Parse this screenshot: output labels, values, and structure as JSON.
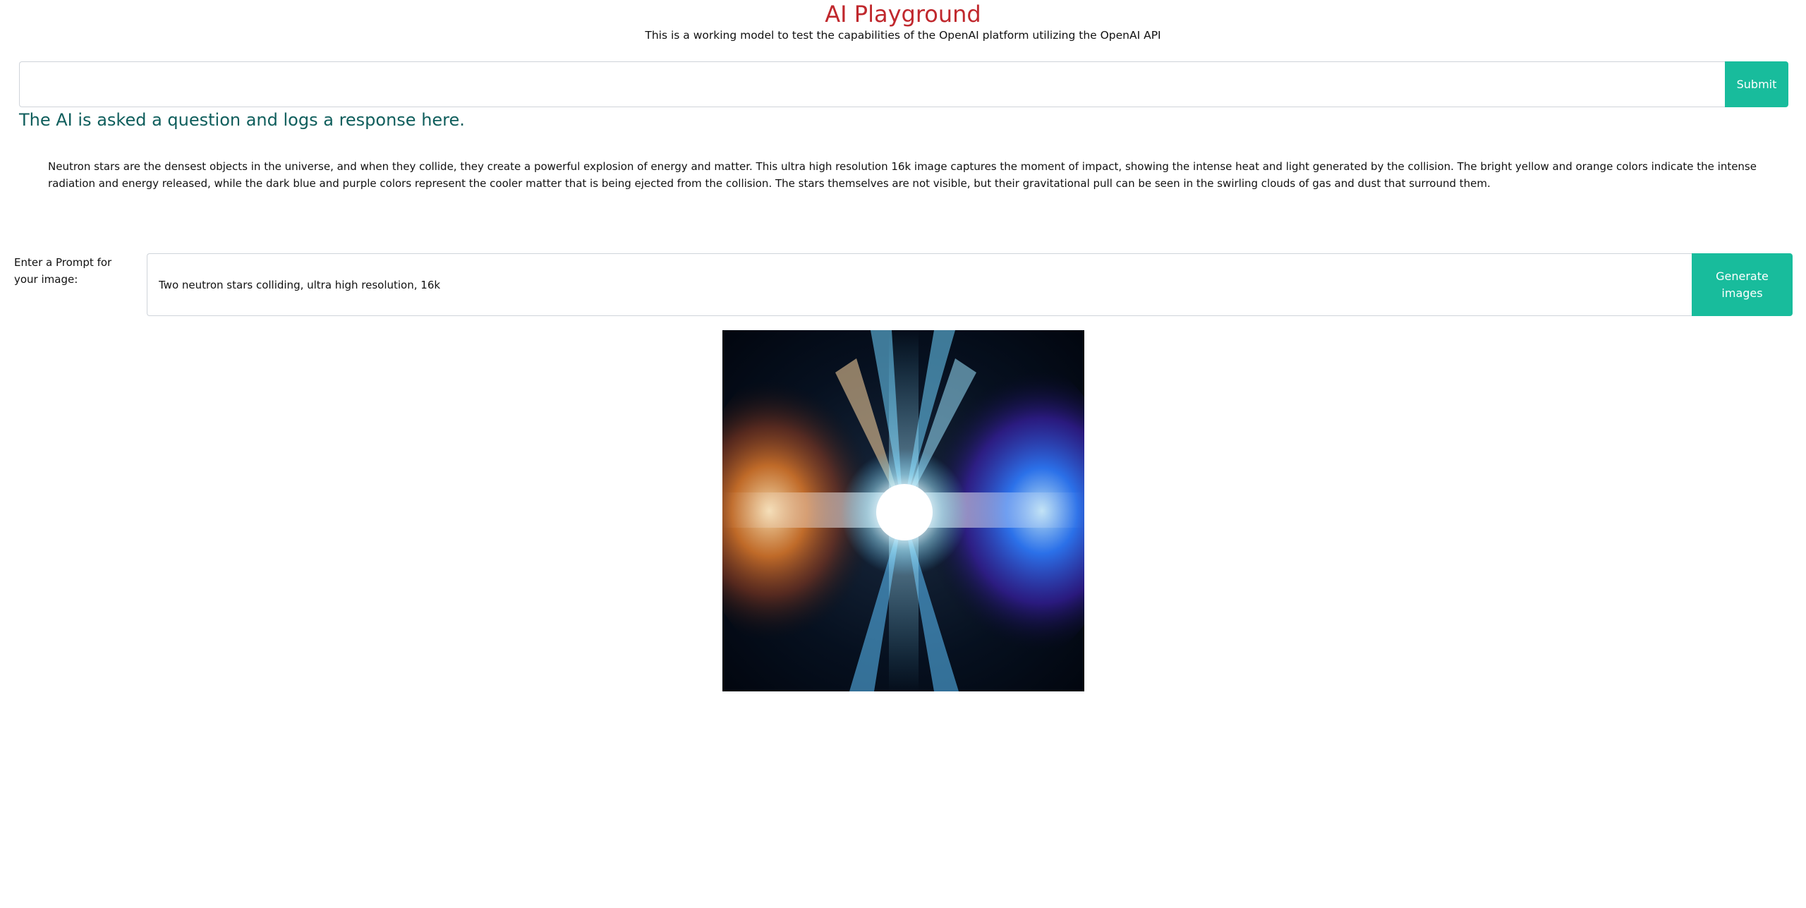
{
  "header": {
    "title": "AI Playground",
    "subtitle": "This is a working model to test the capabilities of the OpenAI platform utilizing the OpenAI API"
  },
  "ask": {
    "input_value": "",
    "submit_label": "Submit"
  },
  "response": {
    "heading": "The AI is asked a question and logs a response here.",
    "text": "Neutron stars are the densest objects in the universe, and when they collide, they create a powerful explosion of energy and matter. This ultra high resolution 16k image captures the moment of impact, showing the intense heat and light generated by the collision. The bright yellow and orange colors indicate the intense radiation and energy released, while the dark blue and purple colors represent the cooler matter that is being ejected from the collision. The stars themselves are not visible, but their gravitational pull can be seen in the swirling clouds of gas and dust that surround them."
  },
  "image_prompt": {
    "label": "Enter a Prompt for your image:",
    "input_value": "Two neutron stars colliding, ultra high resolution, 16k",
    "button_label": "Generate images"
  },
  "colors": {
    "title": "#c0282d",
    "accent": "#18bc9c",
    "heading": "#0f5e5c"
  }
}
